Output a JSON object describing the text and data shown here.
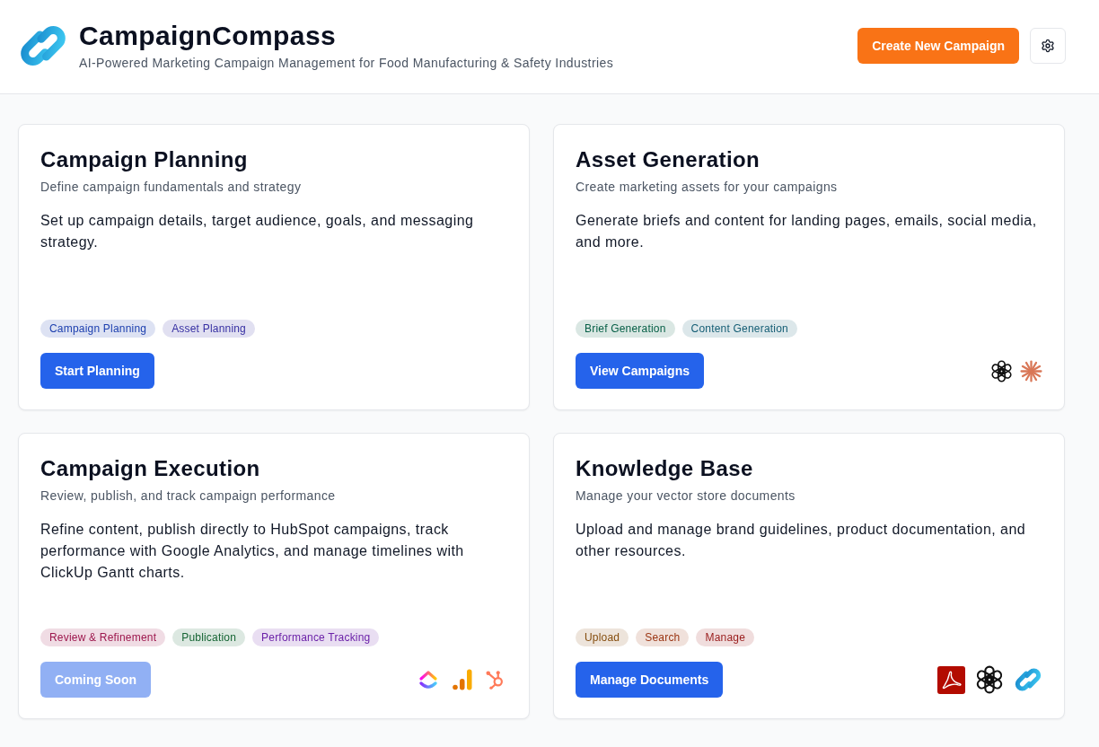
{
  "header": {
    "title": "CampaignCompass",
    "subtitle": "AI-Powered Marketing Campaign Management for Food Manufacturing & Safety Industries",
    "primary_button": {
      "label": "Create New Campaign"
    }
  },
  "cards": [
    {
      "title": "Campaign Planning",
      "subtitle": "Define campaign fundamentals and strategy",
      "description": "Set up campaign details, target audience, goals, and messaging strategy.",
      "tags": [
        {
          "label": "Campaign Planning",
          "color": "#1e40af"
        },
        {
          "label": "Asset Planning",
          "color": "#3730a3"
        }
      ],
      "button": {
        "label": "Start Planning",
        "disabled": false
      }
    },
    {
      "title": "Asset Generation",
      "subtitle": "Create marketing assets for your campaigns",
      "description": "Generate briefs and content for landing pages, emails, social media, and more.",
      "tags": [
        {
          "label": "Brief Generation",
          "color": "#065f46"
        },
        {
          "label": "Content Generation",
          "color": "#155e75"
        }
      ],
      "button": {
        "label": "View Campaigns",
        "disabled": false
      }
    },
    {
      "title": "Campaign Execution",
      "subtitle": "Review, publish, and track campaign performance",
      "description": "Refine content, publish directly to HubSpot campaigns, track performance with Google Analytics, and manage timelines with ClickUp Gantt charts.",
      "tags": [
        {
          "label": "Review & Refinement",
          "color": "#9d174d"
        },
        {
          "label": "Publication",
          "color": "#166534"
        },
        {
          "label": "Performance Tracking",
          "color": "#6b21a8"
        }
      ],
      "button": {
        "label": "Coming Soon",
        "disabled": true
      }
    },
    {
      "title": "Knowledge Base",
      "subtitle": "Manage your vector store documents",
      "description": "Upload and manage brand guidelines, product documentation, and other resources.",
      "tags": [
        {
          "label": "Upload",
          "color": "#854d0e"
        },
        {
          "label": "Search",
          "color": "#9a3412"
        },
        {
          "label": "Manage",
          "color": "#991b1b"
        }
      ],
      "button": {
        "label": "Manage Documents",
        "disabled": false
      }
    }
  ]
}
